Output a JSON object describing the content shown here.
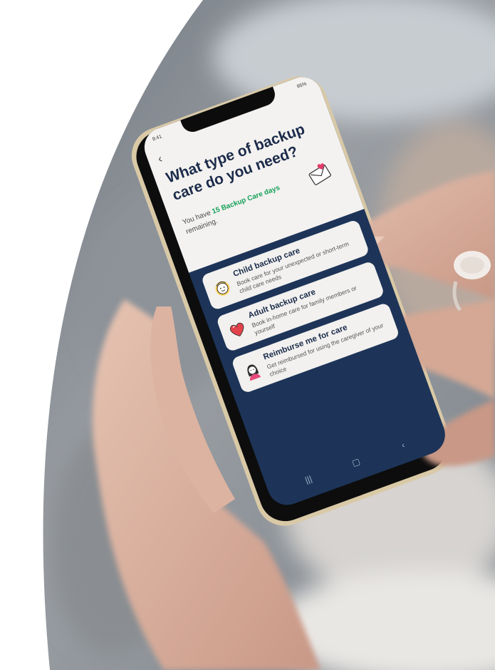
{
  "status_bar": {
    "time": "9:41",
    "battery": "95%"
  },
  "header": {
    "back_icon": "chevron-left-icon",
    "title": "What type of backup care do you need?",
    "remaining_prefix": "You have ",
    "remaining_highlight": "15 Backup Care days",
    "remaining_suffix": " remaining.",
    "illustration_icon": "envelope-heart-icon"
  },
  "options": [
    {
      "icon": "child-face-icon",
      "title": "Child backup care",
      "description": "Book care for your unexpected or short-term child care needs"
    },
    {
      "icon": "heart-icon",
      "title": "Adult backup care",
      "description": "Book in-home care for family members or yourself"
    },
    {
      "icon": "caregiver-portrait-icon",
      "title": "Reimburse me for care",
      "description": "Get reimbursed for using the caregiver of your choice"
    }
  ],
  "navigation_bar": {
    "recents_icon": "recents-icon",
    "home_icon": "home-icon",
    "back_icon": "back-icon"
  },
  "colors": {
    "screen_navy": "#1d3458",
    "header_bg": "#f4f2f0",
    "highlight_green": "#16a05a",
    "card_bg": "#f2f1ef",
    "title_navy": "#1b2b4a"
  }
}
